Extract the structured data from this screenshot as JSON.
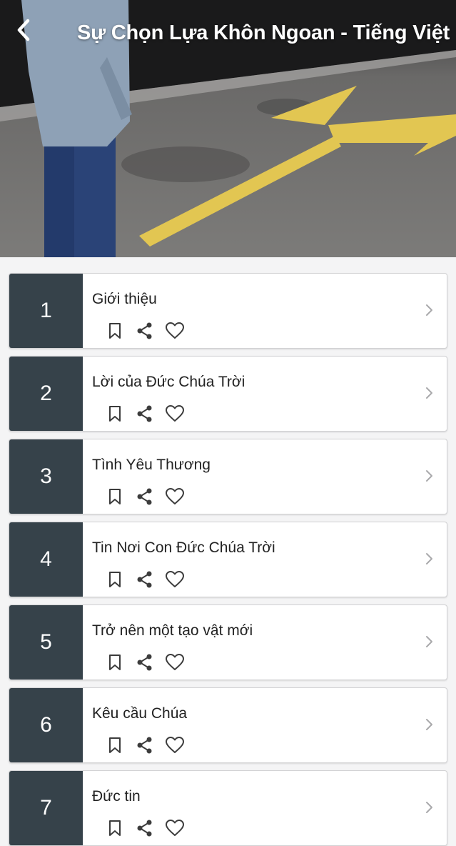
{
  "header": {
    "title": "Sự Chọn Lựa Khôn Ngoan - Tiếng Việt",
    "back_icon": "chevron-left-icon"
  },
  "lessons": [
    {
      "number": "1",
      "title": "Giới thiệu"
    },
    {
      "number": "2",
      "title": "Lời của Đức Chúa Trời"
    },
    {
      "number": "3",
      "title": "Tình Yêu Thương"
    },
    {
      "number": "4",
      "title": "Tin Nơi Con Đức Chúa Trời"
    },
    {
      "number": "5",
      "title": "Trở nên một tạo vật mới"
    },
    {
      "number": "6",
      "title": "Kêu cầu Chúa"
    },
    {
      "number": "7",
      "title": "Đức tin"
    }
  ],
  "icons": {
    "bookmark": "bookmark-icon",
    "share": "share-icon",
    "favorite": "heart-icon",
    "open": "chevron-right-icon"
  },
  "colors": {
    "number_block": "#36424a",
    "road_marking": "#e2c652",
    "card_background": "#ffffff"
  }
}
